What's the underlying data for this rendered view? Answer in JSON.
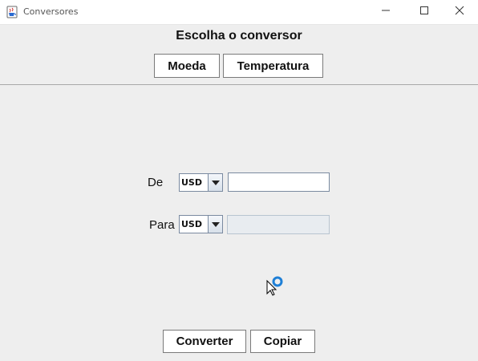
{
  "window": {
    "title": "Conversores"
  },
  "header": {
    "title": "Escolha o conversor",
    "tabs": [
      {
        "label": "Moeda"
      },
      {
        "label": "Temperatura"
      }
    ]
  },
  "form": {
    "from_label": "De",
    "from_currency": "USD",
    "from_value": "",
    "to_label": "Para",
    "to_currency": "USD",
    "to_value": ""
  },
  "actions": {
    "convert_label": "Converter",
    "copy_label": "Copiar"
  },
  "icons": {
    "app": "java-cup-icon",
    "minimize": "minimize-icon",
    "maximize": "maximize-icon",
    "close": "close-icon",
    "combo_arrow": "chevron-down-icon",
    "cursor": "busy-cursor-icon"
  },
  "colors": {
    "background": "#eeeeee",
    "titlebar": "#ffffff",
    "button_border": "#7a7a7a",
    "field_border": "#7a8aa0",
    "disabled_field": "#e8ecf0",
    "busy_ring": "#1e7fd6"
  }
}
